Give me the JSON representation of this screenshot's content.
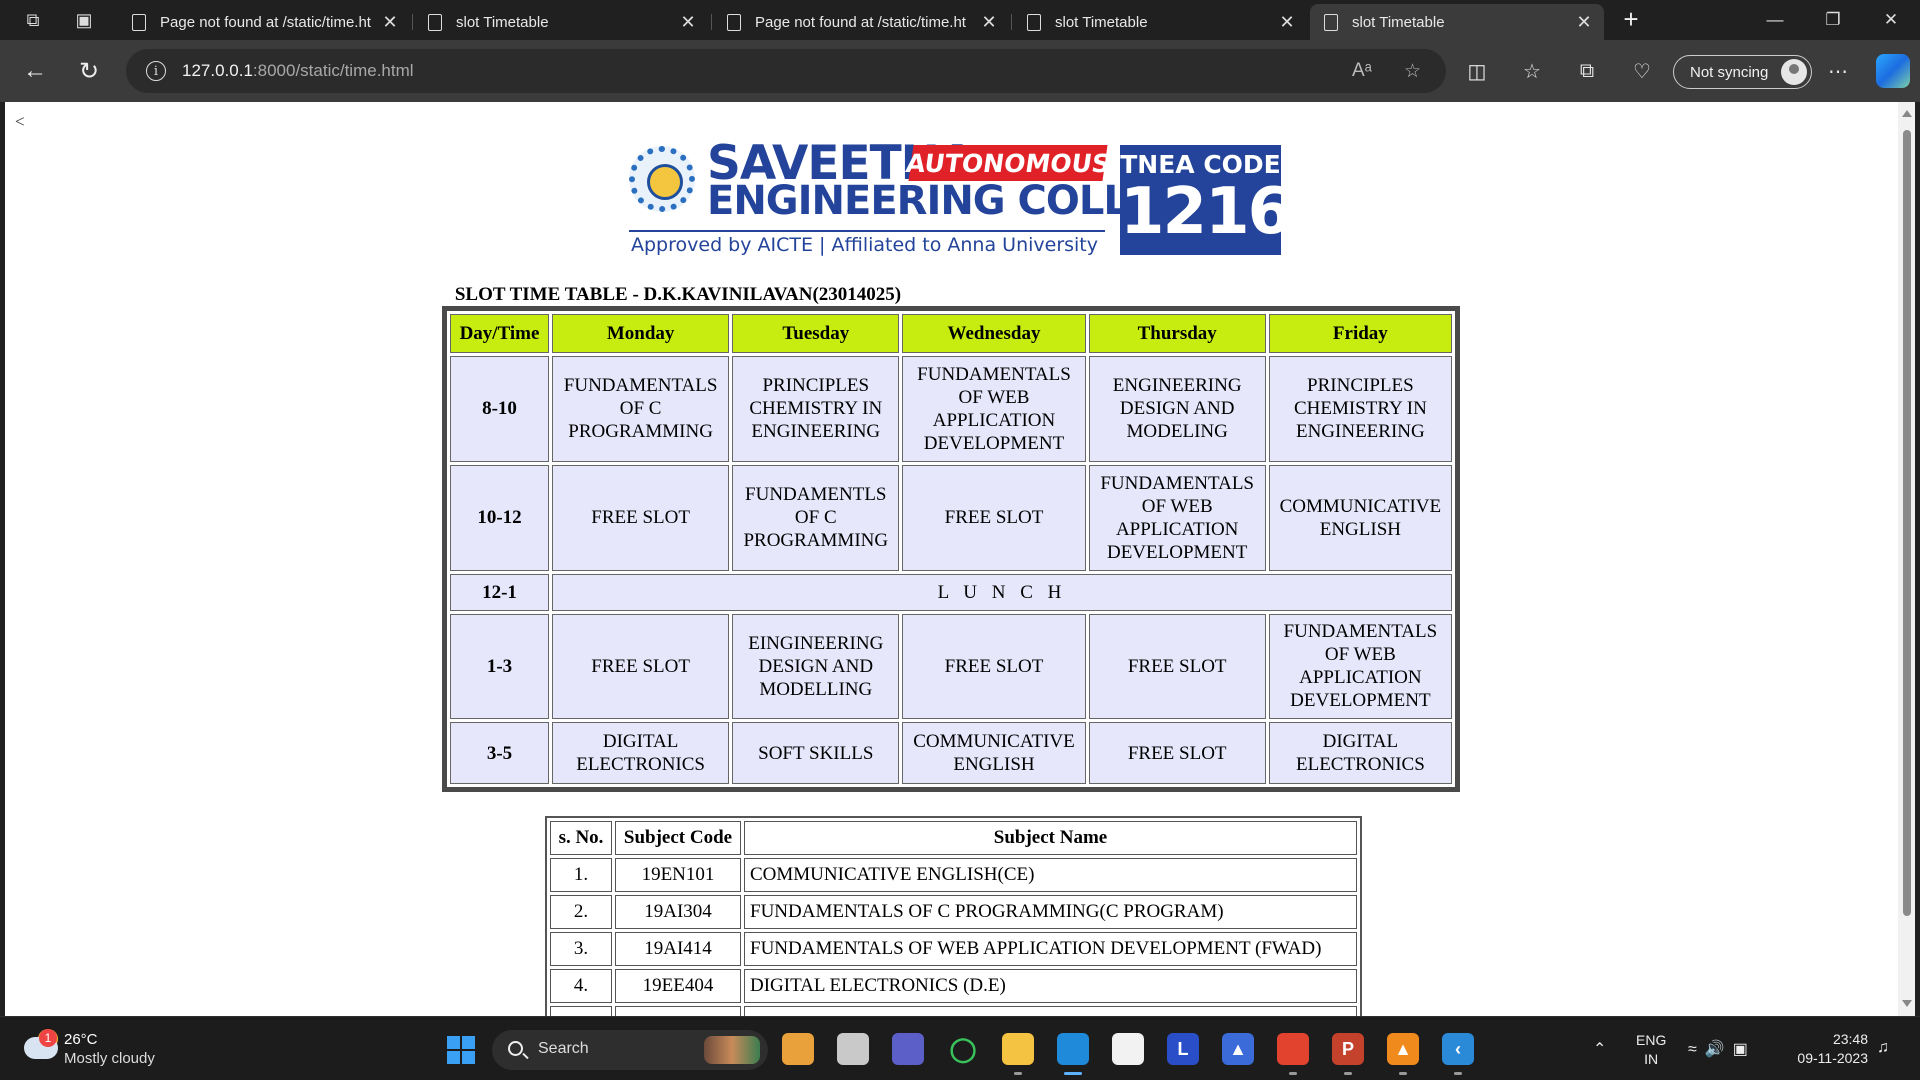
{
  "browser": {
    "tabs": [
      {
        "title": "Page not found at /static/time.ht",
        "active": false
      },
      {
        "title": "slot Timetable",
        "active": false
      },
      {
        "title": "Page not found at /static/time.ht",
        "active": false
      },
      {
        "title": "slot Timetable",
        "active": false
      },
      {
        "title": "slot Timetable",
        "active": true
      }
    ],
    "address": {
      "host": "127.0.0.1",
      "path": ":8000/static/time.html"
    },
    "sync_label": "Not syncing",
    "read_aloud_label": "Aᵃ",
    "new_tab_glyph": "+",
    "minimize_glyph": "—",
    "restore_glyph": "❐",
    "close_glyph": "✕"
  },
  "page": {
    "back_link": "<",
    "logo": {
      "name": "SAVEETHA",
      "badge": "AUTONOMOUS",
      "subtitle": "ENGINEERING COLLEGE",
      "affiliation": "Approved by AICTE | Affiliated to Anna University",
      "tnea_label": "TNEA CODE",
      "tnea_code": "1216"
    },
    "timetable_title": "SLOT TIME TABLE - D.K.KAVINILAVAN(23014025)",
    "timetable": {
      "headers": [
        "Day/Time",
        "Monday",
        "Tuesday",
        "Wednesday",
        "Thursday",
        "Friday"
      ],
      "rows": [
        {
          "time": "8-10",
          "cells": [
            "FUNDAMENTALS OF C PROGRAMMING",
            "PRINCIPLES CHEMISTRY IN ENGINEERING",
            "FUNDAMENTALS OF WEB APPLICATION DEVELOPMENT",
            "ENGINEERING DESIGN AND MODELING",
            "PRINCIPLES CHEMISTRY IN ENGINEERING"
          ]
        },
        {
          "time": "10-12",
          "cells": [
            "FREE SLOT",
            "FUNDAMENTLS OF C PROGRAMMING",
            "FREE SLOT",
            "FUNDAMENTALS OF WEB APPLICATION DEVELOPMENT",
            "COMMUNICATIVE ENGLISH"
          ]
        },
        {
          "time": "12-1",
          "lunch": "L U N C H"
        },
        {
          "time": "1-3",
          "cells": [
            "FREE SLOT",
            "EINGINEERING DESIGN AND MODELLING",
            "FREE SLOT",
            "FREE SLOT",
            "FUNDAMENTALS OF WEB APPLICATION DEVELOPMENT"
          ]
        },
        {
          "time": "3-5",
          "cells": [
            "DIGITAL ELECTRONICS",
            "SOFT SKILLS",
            "COMMUNICATIVE ENGLISH",
            "FREE SLOT",
            "DIGITAL ELECTRONICS"
          ]
        }
      ]
    },
    "subjects": {
      "headers": [
        "s. No.",
        "Subject Code",
        "Subject Name"
      ],
      "rows": [
        [
          "1.",
          "19EN101",
          "COMMUNICATIVE ENGLISH(CE)"
        ],
        [
          "2.",
          "19AI304",
          "FUNDAMENTALS OF C PROGRAMMING(C PROGRAM)"
        ],
        [
          "3.",
          "19AI414",
          "FUNDAMENTALS OF WEB APPLICATION DEVELOPMENT (FWAD)"
        ],
        [
          "4.",
          "19EE404",
          "DIGITAL ELECTRONICS (D.E)"
        ]
      ]
    }
  },
  "taskbar": {
    "weather_temp": "26°C",
    "weather_desc": "Mostly cloudy",
    "weather_badge": "1",
    "search_label": "Search",
    "lang_line1": "ENG",
    "lang_line2": "IN",
    "time": "23:48",
    "date": "09-11-2023",
    "apps": [
      {
        "name": "copilot-app-icon",
        "color": "#e9a23b",
        "glyph": ""
      },
      {
        "name": "file-manager-icon",
        "color": "#c9c9c9",
        "glyph": ""
      },
      {
        "name": "teams-icon",
        "color": "#5b5fc7",
        "glyph": ""
      },
      {
        "name": "refresh-app-icon",
        "color": "#1c1c1c",
        "glyph": "◯"
      },
      {
        "name": "file-explorer-icon",
        "color": "#f5c342",
        "glyph": ""
      },
      {
        "name": "edge-icon",
        "color": "#1f8ad9",
        "glyph": ""
      },
      {
        "name": "store-icon",
        "color": "#f2f2f2",
        "glyph": ""
      },
      {
        "name": "l-app-icon",
        "color": "#2a4ec7",
        "glyph": "L"
      },
      {
        "name": "arc-app-icon",
        "color": "#3a6bd8",
        "glyph": "▲"
      },
      {
        "name": "chrome-icon",
        "color": "#e2432f",
        "glyph": ""
      },
      {
        "name": "powerpoint-icon",
        "color": "#c4422b",
        "glyph": "P"
      },
      {
        "name": "vlc-icon",
        "color": "#f08a1c",
        "glyph": "▲"
      },
      {
        "name": "vscode-icon",
        "color": "#2b8ad8",
        "glyph": "‹"
      }
    ]
  }
}
